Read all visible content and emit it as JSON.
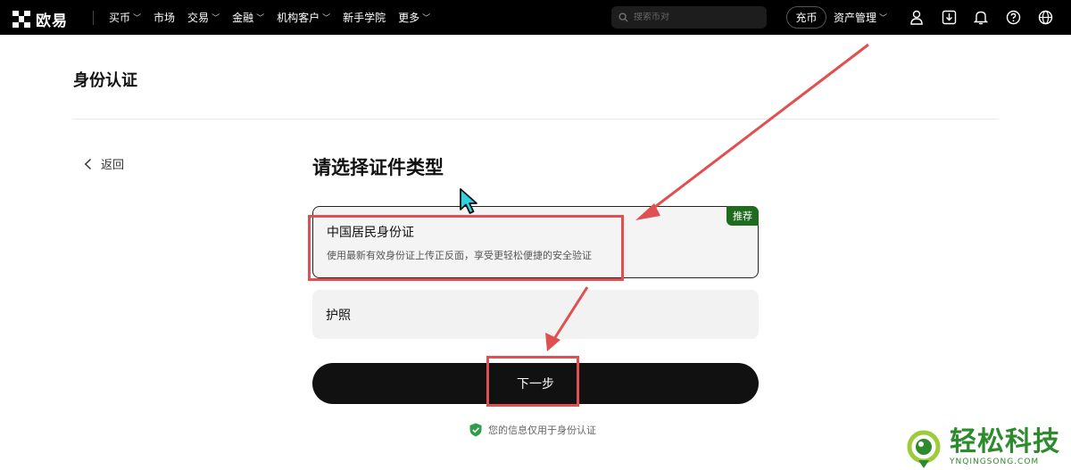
{
  "nav": {
    "brand": "欧易",
    "items": [
      {
        "label": "买币",
        "dropdown": true
      },
      {
        "label": "市场",
        "dropdown": false
      },
      {
        "label": "交易",
        "dropdown": true
      },
      {
        "label": "金融",
        "dropdown": true
      },
      {
        "label": "机构客户",
        "dropdown": true
      },
      {
        "label": "新手学院",
        "dropdown": false
      },
      {
        "label": "更多",
        "dropdown": true
      }
    ],
    "search_placeholder": "搜索币对",
    "deposit_label": "充币",
    "asset_label": "资产管理",
    "icons": [
      "user-icon",
      "download-icon",
      "bell-icon",
      "help-icon",
      "globe-icon"
    ]
  },
  "page": {
    "title": "身份认证",
    "back_label": "返回"
  },
  "main": {
    "heading": "请选择证件类型",
    "options": [
      {
        "title": "中国居民身份证",
        "desc": "使用最新有效身份证上传正反面，享受更轻松便捷的安全验证",
        "badge": "推荐",
        "selected": true
      },
      {
        "title": "护照",
        "desc": "",
        "badge": "",
        "selected": false
      }
    ],
    "next_label": "下一步",
    "privacy_note": "您的信息仅用于身份认证"
  },
  "colors": {
    "nav_bg": "#000000",
    "badge_green": "#1e6b1e",
    "button_dark": "#111111",
    "annotation_red": "#e05050",
    "watermark_green": "#2d8a2d"
  },
  "watermark": {
    "cn": "轻松科技",
    "en": "YNQINGSONG.COM"
  }
}
